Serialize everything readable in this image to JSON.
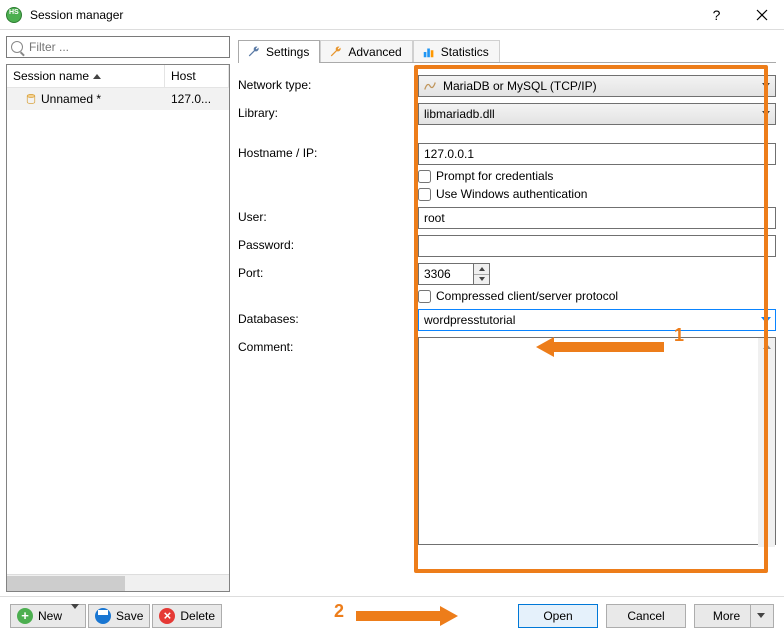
{
  "window": {
    "title": "Session manager"
  },
  "filter": {
    "placeholder": "Filter ..."
  },
  "sessionList": {
    "columns": {
      "name": "Session name",
      "host": "Host"
    },
    "rows": [
      {
        "name": "Unnamed *",
        "host": "127.0..."
      }
    ]
  },
  "tabs": {
    "settings": "Settings",
    "advanced": "Advanced",
    "statistics": "Statistics"
  },
  "form": {
    "networkType": {
      "label": "Network type:",
      "value": "MariaDB or MySQL (TCP/IP)"
    },
    "library": {
      "label": "Library:",
      "value": "libmariadb.dll"
    },
    "hostname": {
      "label": "Hostname / IP:",
      "value": "127.0.0.1"
    },
    "promptCreds": {
      "label": "Prompt for credentials"
    },
    "winAuth": {
      "label": "Use Windows authentication"
    },
    "user": {
      "label": "User:",
      "value": "root"
    },
    "password": {
      "label": "Password:",
      "value": ""
    },
    "port": {
      "label": "Port:",
      "value": "3306"
    },
    "compressed": {
      "label": "Compressed client/server protocol"
    },
    "databases": {
      "label": "Databases:",
      "value": "wordpresstutorial"
    },
    "comment": {
      "label": "Comment:",
      "value": ""
    }
  },
  "bottom": {
    "new": "New",
    "save": "Save",
    "delete": "Delete",
    "open": "Open",
    "cancel": "Cancel",
    "more": "More"
  },
  "annotations": {
    "one": "1",
    "two": "2"
  }
}
